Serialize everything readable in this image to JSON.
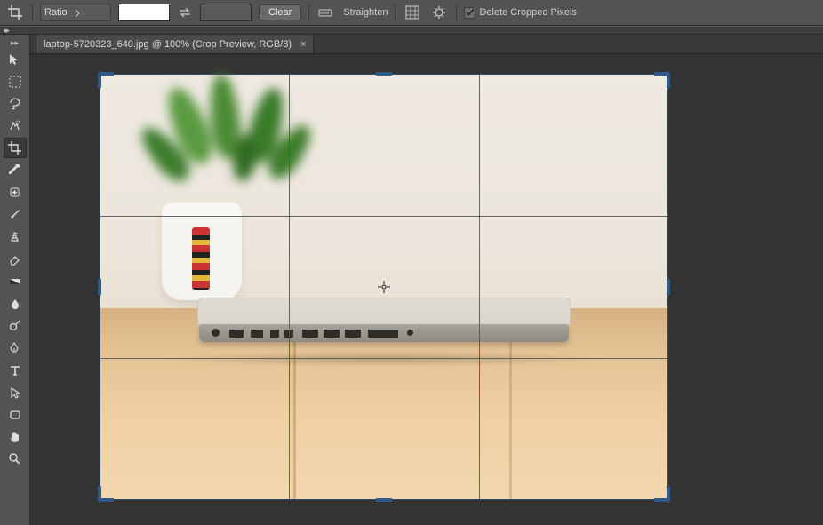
{
  "options": {
    "preset_label": "Ratio",
    "ratio_w": "",
    "ratio_h": "",
    "clear_label": "Clear",
    "straighten_label": "Straighten",
    "delete_cropped_label": "Delete Cropped Pixels",
    "delete_cropped_checked": true
  },
  "document": {
    "tab_title": "laptop-5720323_640.jpg @ 100% (Crop Preview, RGB/8)"
  },
  "tools": {
    "items": [
      {
        "name": "move-tool"
      },
      {
        "name": "marquee-tool"
      },
      {
        "name": "lasso-tool"
      },
      {
        "name": "quick-select-tool"
      },
      {
        "name": "crop-tool",
        "active": true
      },
      {
        "name": "eyedropper-tool"
      },
      {
        "name": "healing-brush-tool"
      },
      {
        "name": "brush-tool"
      },
      {
        "name": "clone-stamp-tool"
      },
      {
        "name": "eraser-tool"
      },
      {
        "name": "gradient-tool"
      },
      {
        "name": "blur-tool"
      },
      {
        "name": "dodge-tool"
      },
      {
        "name": "pen-tool"
      },
      {
        "name": "type-tool"
      },
      {
        "name": "path-select-tool"
      },
      {
        "name": "shape-tool"
      },
      {
        "name": "hand-tool"
      },
      {
        "name": "zoom-tool"
      }
    ]
  }
}
